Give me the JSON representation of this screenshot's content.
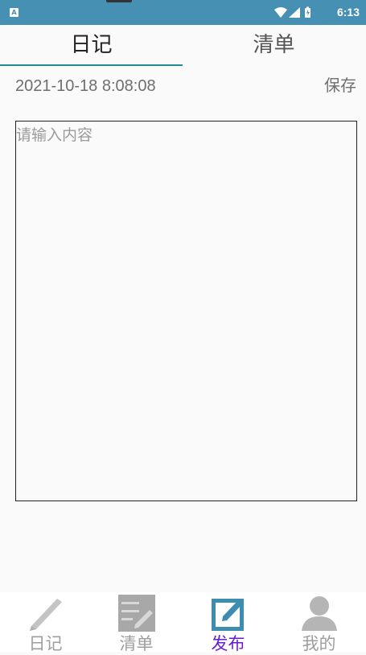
{
  "status_bar": {
    "app_icon": "A",
    "time": "6:13",
    "icons": [
      "wifi-icon",
      "signal-icon",
      "battery-icon"
    ]
  },
  "tabs": [
    {
      "label": "日记",
      "active": true
    },
    {
      "label": "清单",
      "active": false
    }
  ],
  "entry": {
    "date": "2021-10-18 8:08:08",
    "save_label": "保存",
    "placeholder": "请输入内容"
  },
  "bottom_nav": [
    {
      "label": "日记",
      "icon": "pen-icon",
      "active": false
    },
    {
      "label": "清单",
      "icon": "list-edit-icon",
      "active": false
    },
    {
      "label": "发布",
      "icon": "compose-icon",
      "active": true
    },
    {
      "label": "我的",
      "icon": "user-icon",
      "active": false
    }
  ],
  "colors": {
    "status_bar": "#4690b3",
    "tab_indicator": "#1f8f8f",
    "nav_active": "#6a1bd6",
    "nav_inactive": "#9e9e9e"
  }
}
